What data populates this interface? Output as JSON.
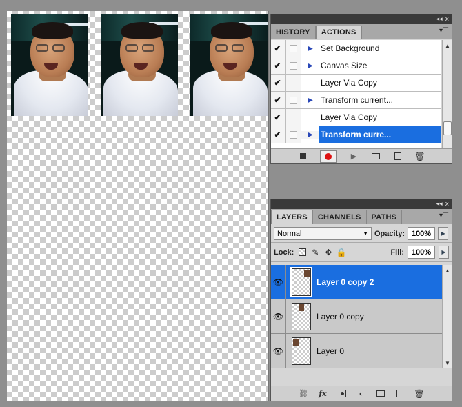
{
  "document": {
    "photos": [
      {
        "name": "photo-1"
      },
      {
        "name": "photo-2"
      },
      {
        "name": "photo-3"
      }
    ]
  },
  "actions_panel": {
    "titlebar_buttons": [
      "◂◂",
      "x"
    ],
    "tabs": [
      {
        "label": "HISTORY",
        "active": false
      },
      {
        "label": "ACTIONS",
        "active": true
      }
    ],
    "menu_icon": "panel-menu-icon",
    "items": [
      {
        "label": "Set Background",
        "checked": true,
        "dialog": true,
        "expandable": true,
        "selected": false
      },
      {
        "label": "Canvas Size",
        "checked": true,
        "dialog": true,
        "expandable": true,
        "selected": false
      },
      {
        "label": "Layer Via Copy",
        "checked": true,
        "dialog": false,
        "expandable": false,
        "selected": false
      },
      {
        "label": "Transform current...",
        "checked": true,
        "dialog": true,
        "expandable": true,
        "selected": false
      },
      {
        "label": "Layer Via Copy",
        "checked": true,
        "dialog": false,
        "expandable": false,
        "selected": false
      },
      {
        "label": "Transform curre...",
        "checked": true,
        "dialog": true,
        "expandable": true,
        "selected": true
      }
    ],
    "footer_buttons": [
      "stop-icon",
      "record-icon",
      "play-icon",
      "new-set-icon",
      "new-action-icon",
      "delete-icon"
    ]
  },
  "layers_panel": {
    "titlebar_buttons": [
      "◂◂",
      "x"
    ],
    "tabs": [
      {
        "label": "LAYERS",
        "active": true
      },
      {
        "label": "CHANNELS",
        "active": false
      },
      {
        "label": "PATHS",
        "active": false
      }
    ],
    "blend_mode": "Normal",
    "opacity_label": "Opacity:",
    "opacity_value": "100%",
    "lock_label": "Lock:",
    "fill_label": "Fill:",
    "fill_value": "100%",
    "layers": [
      {
        "name": "Layer 0 copy 2",
        "visible": true,
        "selected": true
      },
      {
        "name": "Layer 0 copy",
        "visible": true,
        "selected": false
      },
      {
        "name": "Layer 0",
        "visible": true,
        "selected": false
      }
    ],
    "footer_buttons": [
      "link-icon",
      "fx-icon",
      "mask-icon",
      "adjustment-icon",
      "group-icon",
      "new-layer-icon",
      "delete-icon"
    ],
    "fx_label": "fx"
  }
}
